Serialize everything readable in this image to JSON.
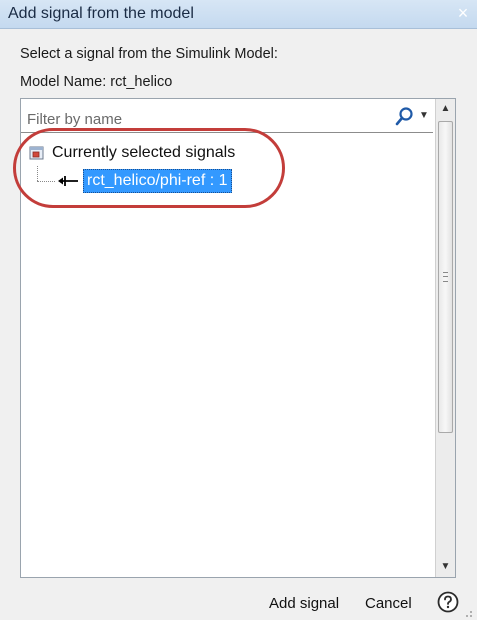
{
  "window": {
    "title": "Add signal from the model",
    "close_glyph": "×"
  },
  "labels": {
    "select_prompt": "Select a signal from the Simulink Model:",
    "model_name": "Model Name: rct_helico"
  },
  "filter": {
    "placeholder": "Filter by name",
    "value": ""
  },
  "tree": {
    "root": {
      "label": "Currently selected signals",
      "icon": "model-icon"
    },
    "children": [
      {
        "label": "rct_helico/phi-ref : 1",
        "icon": "signal-line-icon",
        "selected": true
      }
    ]
  },
  "buttons": {
    "add_signal": "Add signal",
    "cancel": "Cancel",
    "help": "help-icon"
  },
  "colors": {
    "selection": "#3399ff",
    "highlight_ring": "#c33d3a",
    "titlebar": "#c9dcf0"
  }
}
